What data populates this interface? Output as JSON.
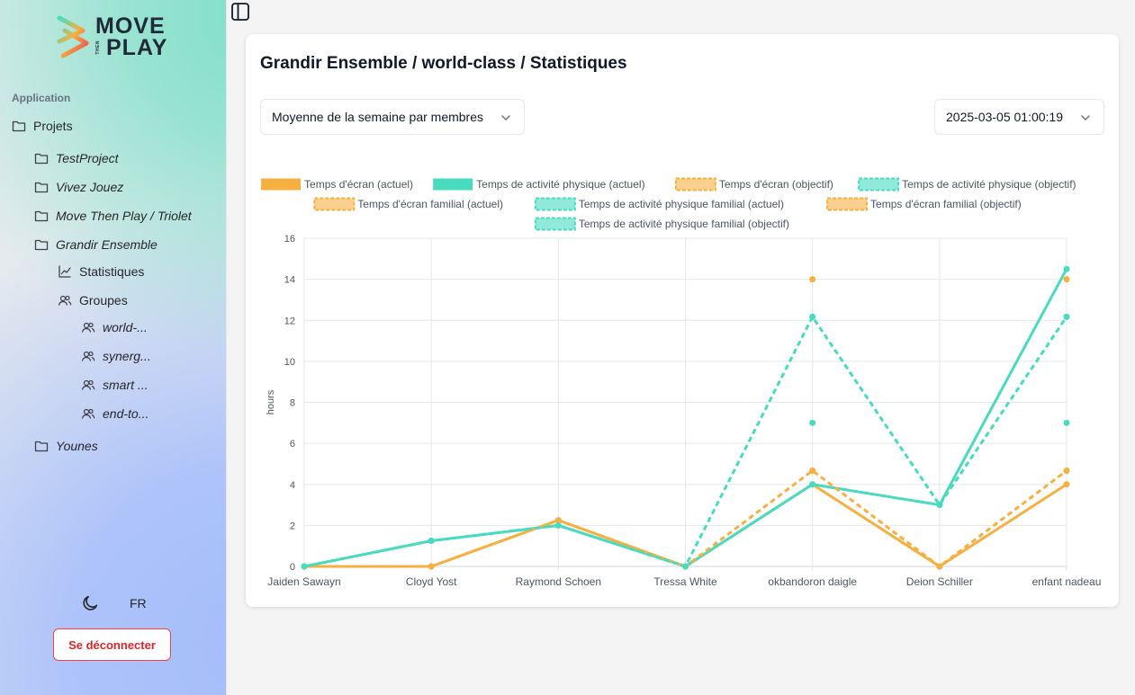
{
  "brand": {
    "line1": "MOVE",
    "then": "THEN",
    "line2": "PLAY"
  },
  "sidebar": {
    "section_label": "Application",
    "projects_label": "Projets",
    "projects": [
      {
        "label": "TestProject"
      },
      {
        "label": "Vivez Jouez"
      },
      {
        "label": "Move Then Play / Triolet"
      },
      {
        "label": "Grandir Ensemble"
      }
    ],
    "sub_items": [
      {
        "label": "Statistiques"
      },
      {
        "label": "Groupes"
      }
    ],
    "groups": [
      {
        "label": "world-..."
      },
      {
        "label": "synerg..."
      },
      {
        "label": "smart ..."
      },
      {
        "label": "end-to..."
      }
    ],
    "extra_project": {
      "label": "Younes"
    },
    "language": "FR",
    "logout_label": "Se déconnecter"
  },
  "main": {
    "title": "Grandir Ensemble / world-class / Statistiques",
    "metric_select": "Moyenne de la semaine par membres",
    "date_select": "2025-03-05 01:00:19"
  },
  "colors": {
    "orange": "#f5b041",
    "teal": "#48dbc0",
    "danger": "#ef4444"
  },
  "chart_data": {
    "type": "line",
    "ylabel": "hours",
    "ylim": [
      0,
      16
    ],
    "yticks": [
      0,
      2,
      4,
      6,
      8,
      10,
      12,
      14,
      16
    ],
    "categories": [
      "Jaiden Sawayn",
      "Cloyd Yost",
      "Raymond Schoen",
      "Tressa White",
      "okbandoron daigle",
      "Deion Schiller",
      "enfant nadeau"
    ],
    "grid": true,
    "legend_position": "top",
    "series": [
      {
        "name": "Temps d'écran (actuel)",
        "color": "#f5b041",
        "dashed": false,
        "values": [
          0,
          0,
          2.25,
          0,
          4,
          0,
          4
        ]
      },
      {
        "name": "Temps de activité physique (actuel)",
        "color": "#48dbc0",
        "dashed": false,
        "values": [
          0,
          1.25,
          2,
          0,
          4,
          3,
          14.5
        ]
      },
      {
        "name": "Temps d'écran (objectif)",
        "color": "#f5b041",
        "dashed": true,
        "values": [
          0,
          0,
          2.25,
          0,
          4.67,
          0,
          4.67
        ]
      },
      {
        "name": "Temps de activité physique (objectif)",
        "color": "#48dbc0",
        "dashed": true,
        "values": [
          0,
          1.25,
          2,
          0,
          12.17,
          3,
          12.17
        ]
      },
      {
        "name": "Temps d'écran familial (actuel)",
        "color": "#f5b041",
        "dashed": true,
        "values": [
          null,
          null,
          null,
          null,
          14,
          null,
          14
        ]
      },
      {
        "name": "Temps de activité physique familial (actuel)",
        "color": "#48dbc0",
        "dashed": true,
        "values": [
          null,
          null,
          null,
          null,
          7,
          null,
          7
        ]
      },
      {
        "name": "Temps d'écran familial (objectif)",
        "color": "#f5b041",
        "dashed": true,
        "values": [
          null,
          null,
          null,
          null,
          4.67,
          null,
          4.67
        ]
      },
      {
        "name": "Temps de activité physique familial (objectif)",
        "color": "#48dbc0",
        "dashed": true,
        "values": [
          null,
          null,
          null,
          null,
          12.17,
          null,
          12.17
        ]
      }
    ]
  }
}
